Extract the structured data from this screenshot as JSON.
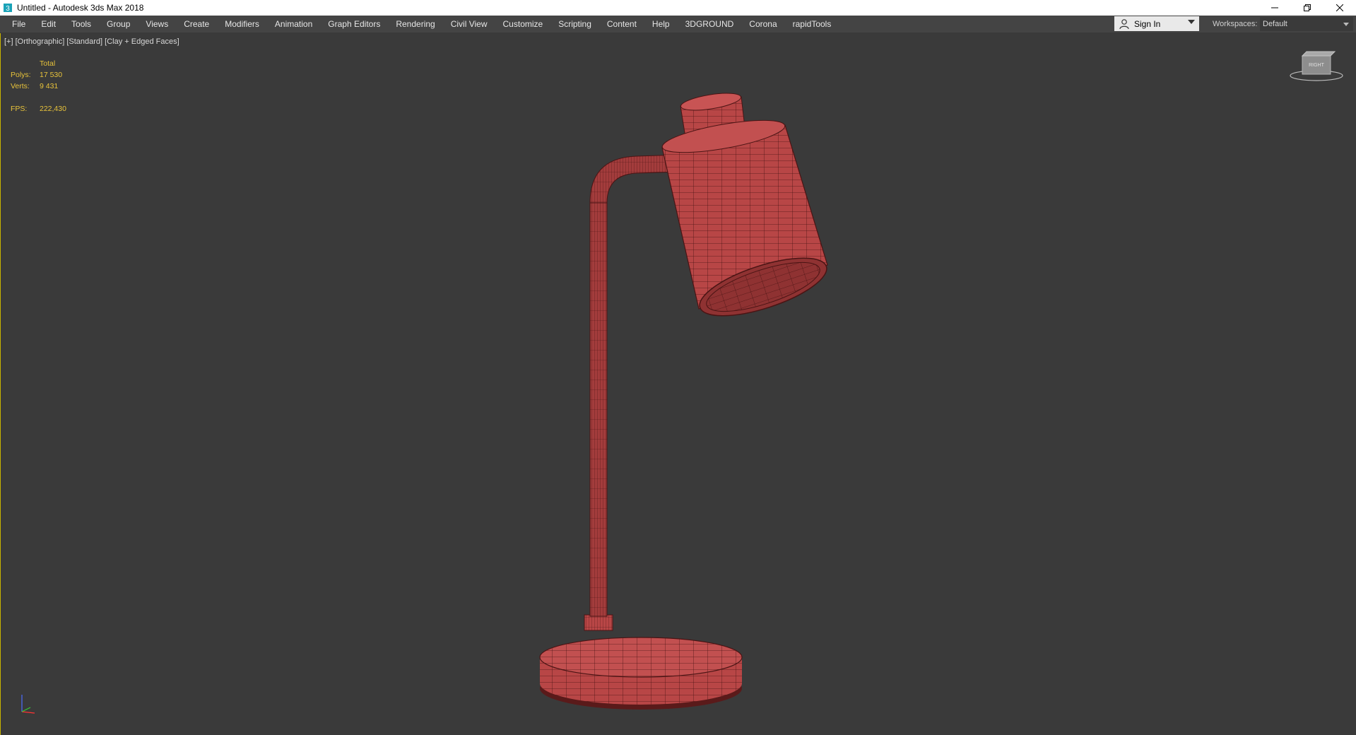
{
  "window": {
    "title": "Untitled - Autodesk 3ds Max 2018",
    "app_icon": "3dsmax-icon",
    "controls": [
      "minimize-icon",
      "restore-icon",
      "close-icon"
    ]
  },
  "menu": {
    "items": [
      "File",
      "Edit",
      "Tools",
      "Group",
      "Views",
      "Create",
      "Modifiers",
      "Animation",
      "Graph Editors",
      "Rendering",
      "Civil View",
      "Customize",
      "Scripting",
      "Content",
      "Help",
      "3DGROUND",
      "Corona",
      "rapidTools"
    ],
    "sign_in": "Sign In",
    "workspaces_label": "Workspaces:",
    "workspaces_value": "Default"
  },
  "viewport": {
    "label": "[+] [Orthographic] [Standard] [Clay + Edged Faces]",
    "stats": {
      "header": "Total",
      "polys_label": "Polys:",
      "polys_value": "17 530",
      "verts_label": "Verts:",
      "verts_value": "9 431",
      "fps_label": "FPS:",
      "fps_value": "222,430"
    },
    "viewcube_label": "RIGHT",
    "model_color": "#b84646",
    "wire_color": "#4a1414"
  }
}
